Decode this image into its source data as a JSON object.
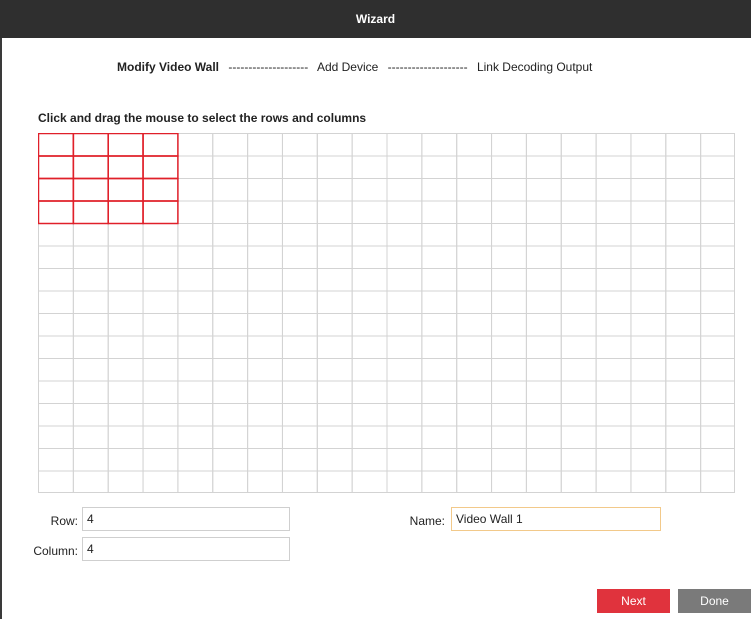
{
  "window": {
    "title": "Wizard"
  },
  "steps": {
    "modify": "Modify Video Wall",
    "separator": "--------------------",
    "add": "Add Device",
    "link": "Link Decoding Output"
  },
  "instruction": "Click and drag the mouse to select the rows and columns",
  "grid": {
    "rows": 16,
    "columns": 20,
    "selected_rows": 4,
    "selected_columns": 4,
    "line_color": "#d3d3d3",
    "selection_color": "#e0202a"
  },
  "form": {
    "row_label": "Row:",
    "row_value": "4",
    "column_label": "Column:",
    "column_value": "4",
    "name_label": "Name:",
    "name_value": "Video Wall 1"
  },
  "buttons": {
    "next": "Next",
    "done": "Done"
  },
  "colors": {
    "titlebar": "#2f2f2f",
    "next_button": "#e0333d",
    "done_button": "#7a7a7a"
  }
}
